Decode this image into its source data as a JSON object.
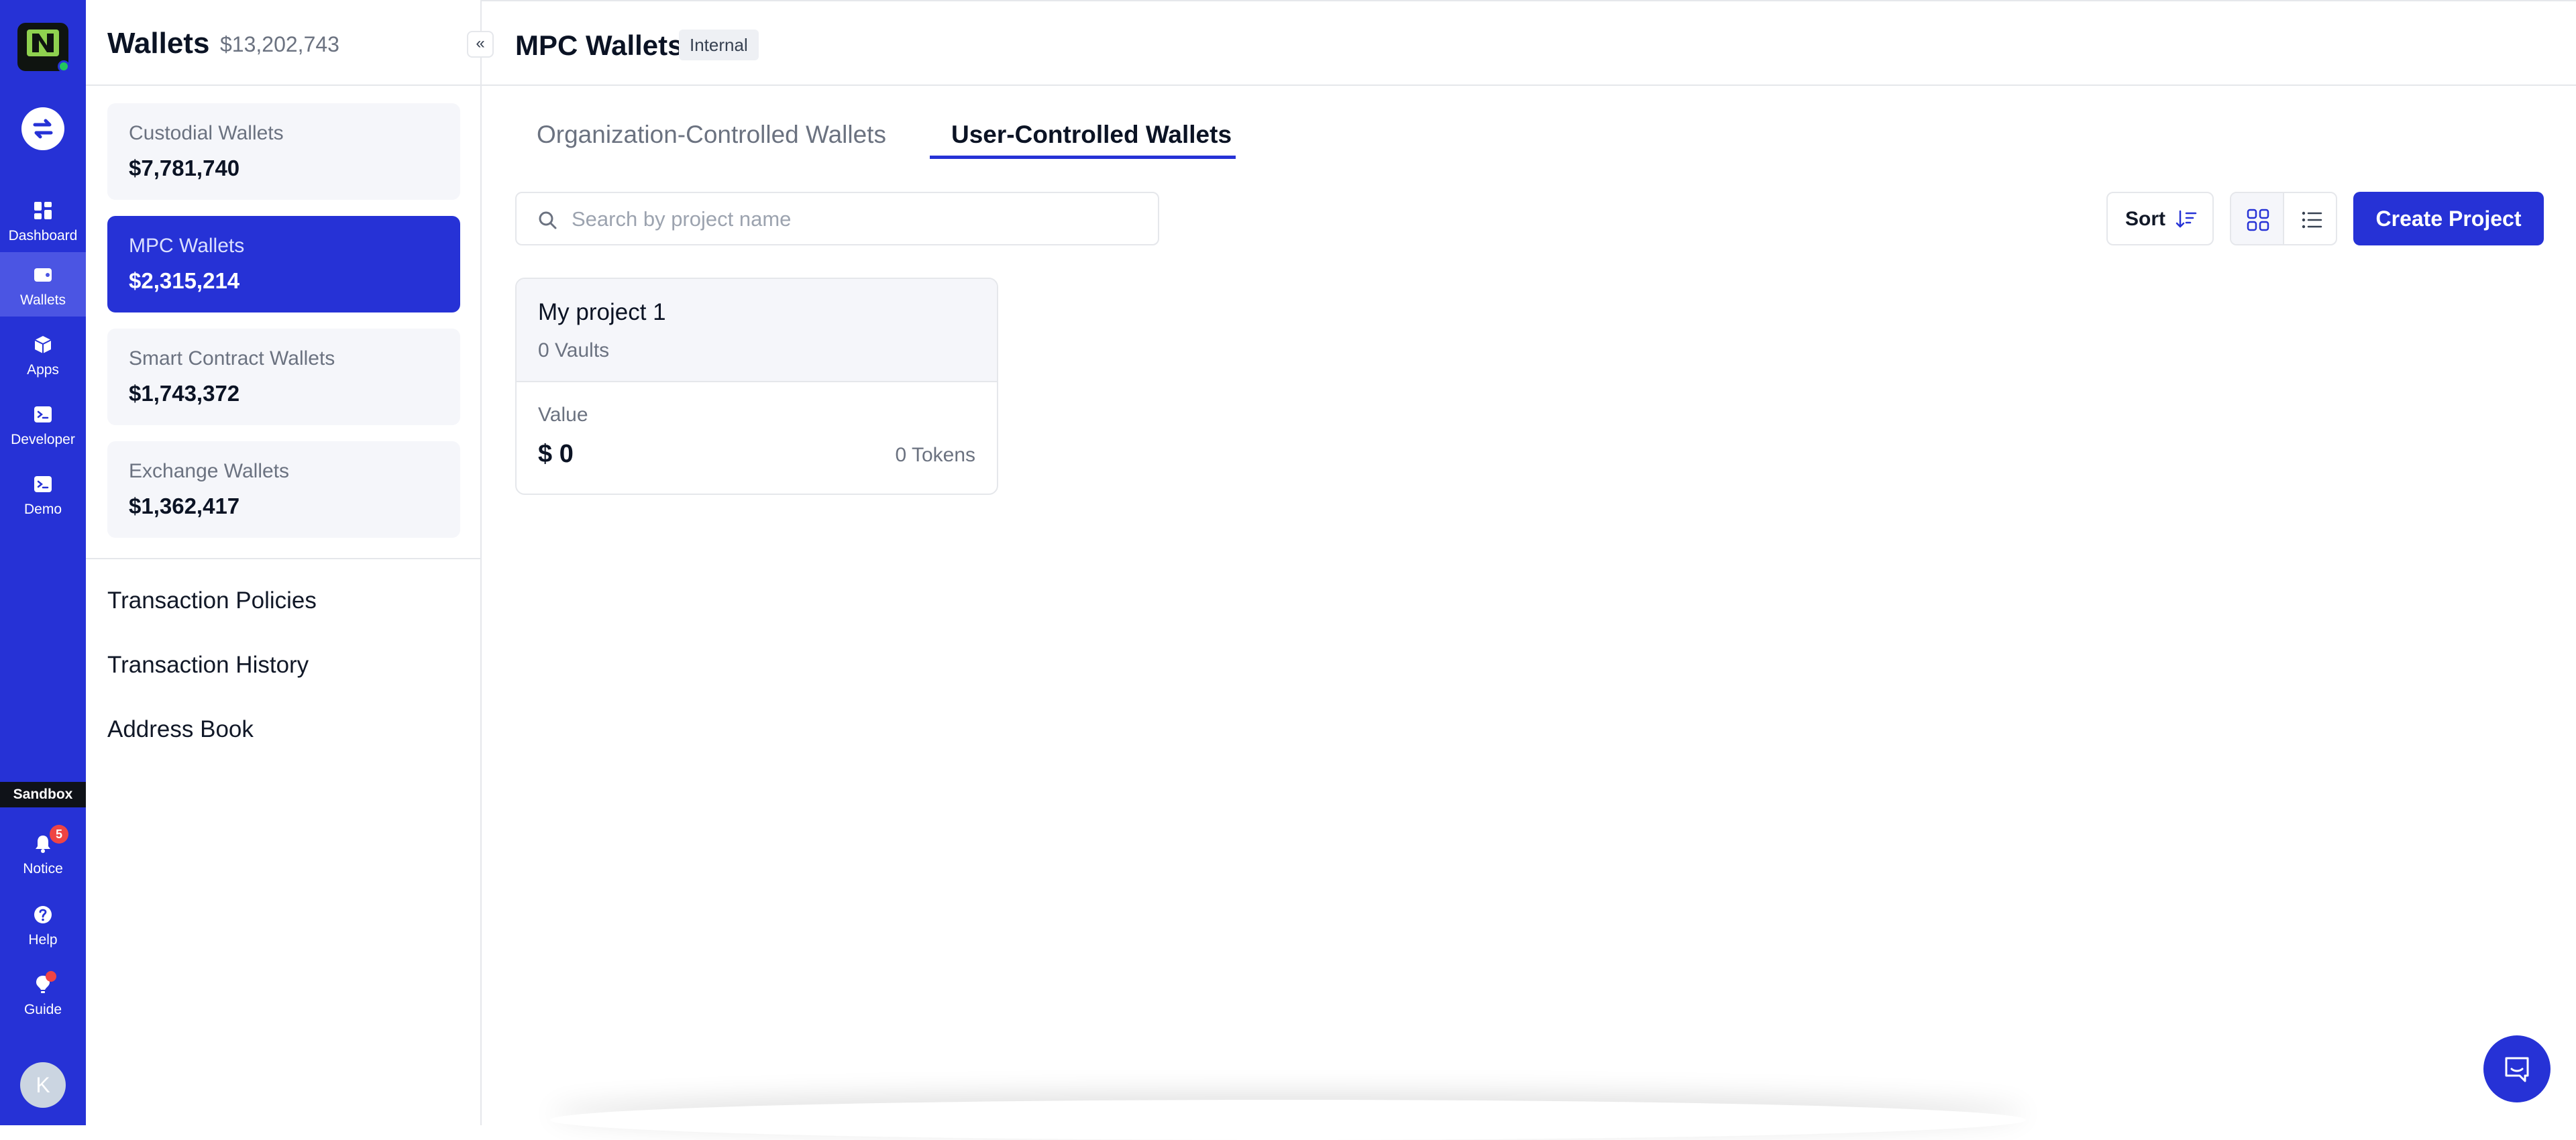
{
  "rail": {
    "nav": [
      {
        "label": "Dashboard",
        "icon": "dashboard-icon"
      },
      {
        "label": "Wallets",
        "icon": "wallet-icon",
        "active": true
      },
      {
        "label": "Apps",
        "icon": "apps-icon"
      },
      {
        "label": "Developer",
        "icon": "terminal-icon"
      },
      {
        "label": "Demo",
        "icon": "terminal-icon"
      }
    ],
    "sandbox_label": "Sandbox",
    "notice": {
      "label": "Notice",
      "badge": "5"
    },
    "help_label": "Help",
    "guide_label": "Guide",
    "avatar_initial": "K"
  },
  "sidebar": {
    "title": "Wallets",
    "total": "$13,202,743",
    "collapse_label": "«",
    "wallets": [
      {
        "name": "Custodial Wallets",
        "value": "$7,781,740"
      },
      {
        "name": "MPC Wallets",
        "value": "$2,315,214",
        "active": true
      },
      {
        "name": "Smart Contract Wallets",
        "value": "$1,743,372"
      },
      {
        "name": "Exchange Wallets",
        "value": "$1,362,417"
      }
    ],
    "links": [
      "Transaction Policies",
      "Transaction History",
      "Address Book"
    ]
  },
  "header": {
    "title": "MPC Wallets",
    "tag": "Internal"
  },
  "tabs": [
    {
      "label": "Organization-Controlled Wallets",
      "active": false
    },
    {
      "label": "User-Controlled Wallets",
      "active": true
    }
  ],
  "search": {
    "placeholder": "Search by project name",
    "value": ""
  },
  "toolbar": {
    "sort_label": "Sort",
    "create_label": "Create Project"
  },
  "projects": [
    {
      "name": "My project 1",
      "vaults": "0 Vaults",
      "value_label": "Value",
      "value": "$ 0",
      "tokens": "0 Tokens"
    }
  ],
  "colors": {
    "accent": "#2632d6",
    "rail_active": "#4b55e3",
    "badge": "#ef4444"
  }
}
